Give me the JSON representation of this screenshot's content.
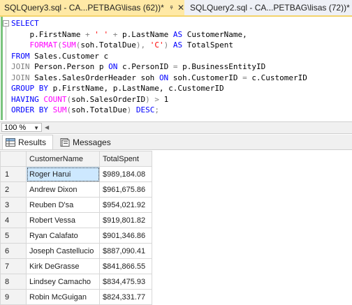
{
  "tabs": [
    {
      "label": "SQLQuery3.sql - CA...PETBAG\\lisas (62))*",
      "active": true
    },
    {
      "label": "SQLQuery2.sql - CA...PETBAG\\lisas (72))*",
      "active": false
    }
  ],
  "editor": {
    "lines": [
      [
        [
          "kw",
          "SELECT"
        ]
      ],
      [
        [
          "id",
          "    p.FirstName "
        ],
        [
          "op",
          "+"
        ],
        [
          "str",
          " ' ' "
        ],
        [
          "op",
          "+"
        ],
        [
          "id",
          " p.LastName "
        ],
        [
          "kw",
          "AS"
        ],
        [
          "id",
          " CustomerName,"
        ]
      ],
      [
        [
          "id",
          "    "
        ],
        [
          "fn",
          "FORMAT"
        ],
        [
          "op",
          "("
        ],
        [
          "fn",
          "SUM"
        ],
        [
          "op",
          "("
        ],
        [
          "id",
          "soh.TotalDue"
        ],
        [
          "op",
          "),"
        ],
        [
          "str",
          " 'C'"
        ],
        [
          "op",
          ")"
        ],
        [
          "id",
          " "
        ],
        [
          "kw",
          "AS"
        ],
        [
          "id",
          " TotalSpent"
        ]
      ],
      [
        [
          "kw",
          "FROM"
        ],
        [
          "id",
          " Sales.Customer c"
        ]
      ],
      [
        [
          "op",
          "JOIN"
        ],
        [
          "id",
          " Person.Person p "
        ],
        [
          "kw",
          "ON"
        ],
        [
          "id",
          " c.PersonID "
        ],
        [
          "op",
          "="
        ],
        [
          "id",
          " p.BusinessEntityID"
        ]
      ],
      [
        [
          "op",
          "JOIN"
        ],
        [
          "id",
          " Sales.SalesOrderHeader soh "
        ],
        [
          "kw",
          "ON"
        ],
        [
          "id",
          " soh.CustomerID "
        ],
        [
          "op",
          "="
        ],
        [
          "id",
          " c.CustomerID"
        ]
      ],
      [
        [
          "kw",
          "GROUP BY"
        ],
        [
          "id",
          " p.FirstName, p.LastName, c.CustomerID"
        ]
      ],
      [
        [
          "kw",
          "HAVING"
        ],
        [
          "id",
          " "
        ],
        [
          "fn",
          "COUNT"
        ],
        [
          "op",
          "("
        ],
        [
          "id",
          "soh.SalesOrderID"
        ],
        [
          "op",
          ")"
        ],
        [
          "id",
          " "
        ],
        [
          "op",
          ">"
        ],
        [
          "id",
          " 1"
        ]
      ],
      [
        [
          "kw",
          "ORDER BY"
        ],
        [
          "id",
          " "
        ],
        [
          "fn",
          "SUM"
        ],
        [
          "op",
          "("
        ],
        [
          "id",
          "soh.TotalDue"
        ],
        [
          "op",
          ")"
        ],
        [
          "id",
          " "
        ],
        [
          "kw",
          "DESC"
        ],
        [
          "op",
          ";"
        ]
      ]
    ]
  },
  "zoom": {
    "value": "100 %"
  },
  "results_tabs": {
    "results": "Results",
    "messages": "Messages"
  },
  "grid": {
    "columns": [
      "CustomerName",
      "TotalSpent"
    ],
    "rows": [
      [
        "1",
        "Roger Harui",
        "$989,184.08"
      ],
      [
        "2",
        "Andrew Dixon",
        "$961,675.86"
      ],
      [
        "3",
        "Reuben D'sa",
        "$954,021.92"
      ],
      [
        "4",
        "Robert Vessa",
        "$919,801.82"
      ],
      [
        "5",
        "Ryan Calafato",
        "$901,346.86"
      ],
      [
        "6",
        "Joseph Castellucio",
        "$887,090.41"
      ],
      [
        "7",
        "Kirk DeGrasse",
        "$841,866.55"
      ],
      [
        "8",
        "Lindsey Camacho",
        "$834,475.93"
      ],
      [
        "9",
        "Robin McGuigan",
        "$824,331.77"
      ]
    ]
  },
  "colors": {
    "active_tab": "#ffe9a6",
    "keyword": "#0000ff",
    "function": "#ff00ff",
    "string": "#ff0000",
    "selection": "#cde8ff"
  }
}
